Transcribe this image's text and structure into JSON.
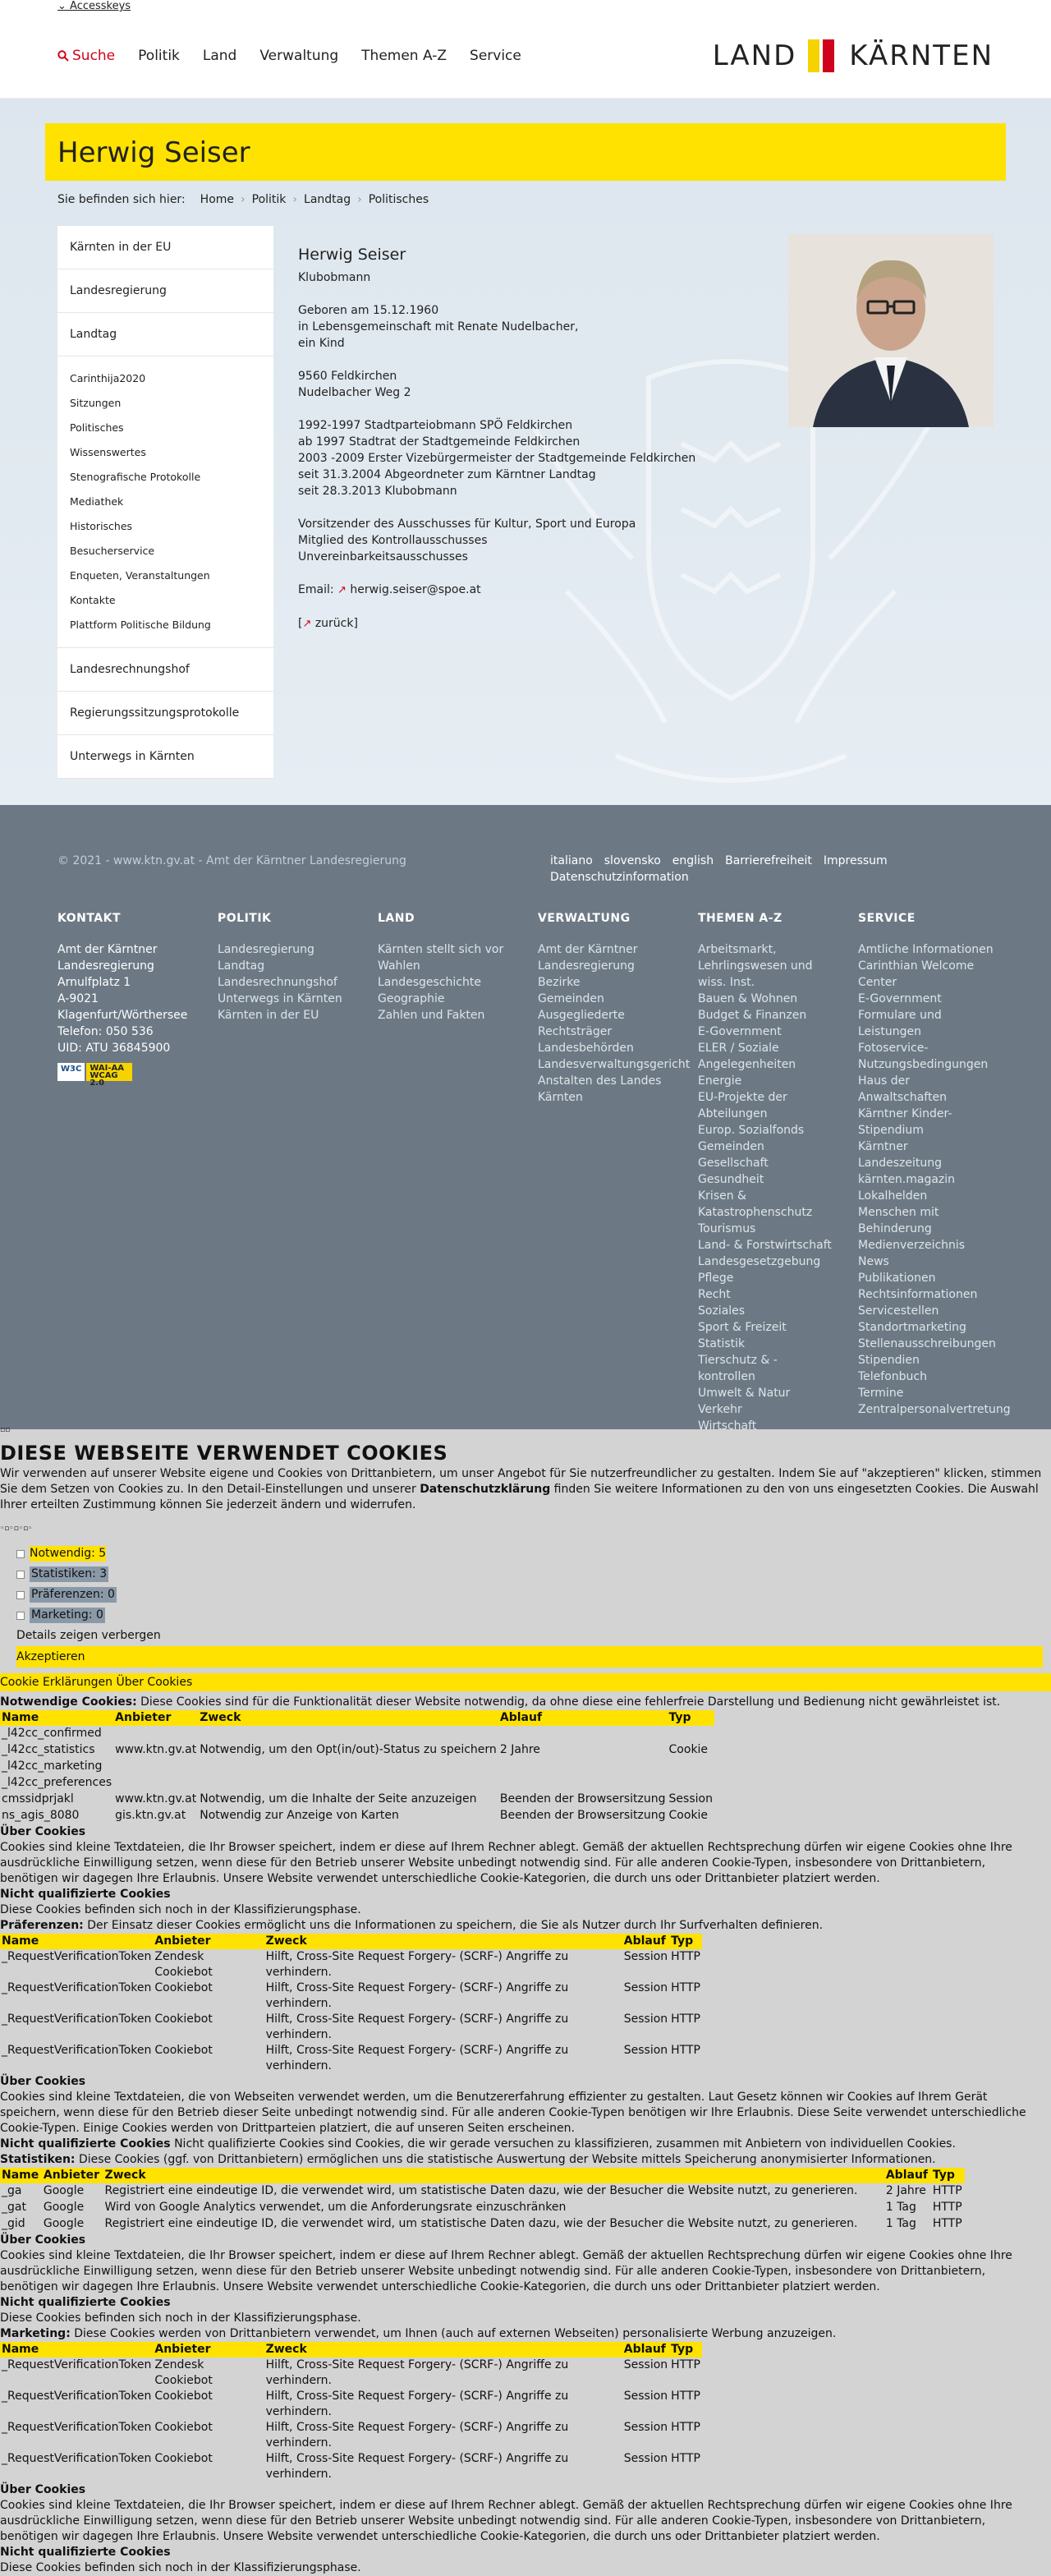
{
  "topbar": {
    "accesskeys": "Accesskeys"
  },
  "nav": {
    "search": "Suche",
    "items": [
      "Politik",
      "Land",
      "Verwaltung",
      "Themen A-Z",
      "Service"
    ]
  },
  "logo": {
    "left": "LAND",
    "right": "KÄRNTEN"
  },
  "page": {
    "title": "Herwig Seiser"
  },
  "breadcrumb": {
    "label": "Sie befinden sich hier:",
    "items": [
      "Home",
      "Politik",
      "Landtag",
      "Politisches"
    ]
  },
  "sidebar": {
    "top": [
      "Kärnten in der EU",
      "Landesregierung",
      "Landtag"
    ],
    "sub": [
      "Carinthija2020",
      "Sitzungen",
      "Politisches",
      "Wissenswertes",
      "Stenografische Protokolle",
      "Mediathek",
      "Historisches",
      "Besucherservice",
      "Enqueten, Veranstaltungen",
      "Kontakte",
      "Plattform Politische Bildung"
    ],
    "bottom": [
      "Landesrechnungshof",
      "Regierungssitzungsprotokolle",
      "Unterwegs in Kärnten"
    ]
  },
  "content": {
    "name": "Herwig Seiser",
    "role": "Klubobmann",
    "p1": [
      "Geboren am 15.12.1960",
      "in Lebensgemeinschaft mit Renate Nudelbacher,",
      "ein Kind"
    ],
    "p2": [
      "9560 Feldkirchen",
      "Nudelbacher Weg 2"
    ],
    "p3": [
      "1992-1997 Stadtparteiobmann SPÖ Feldkirchen",
      "ab 1997 Stadtrat der Stadtgemeinde Feldkirchen",
      "2003 -2009 Erster Vizebürgermeister der Stadtgemeinde Feldkirchen",
      "seit 31.3.2004 Abgeordneter zum Kärntner Landtag",
      "seit 28.3.2013 Klubobmann"
    ],
    "p4": [
      "Vorsitzender des Ausschusses für Kultur, Sport und Europa",
      "Mitglied des Kontrollausschusses",
      "Unvereinbarkeitsausschusses"
    ],
    "email_label": "Email:",
    "email": "herwig.seiser@spoe.at",
    "back": "zurück"
  },
  "footer": {
    "copyright": "© 2021 - www.ktn.gv.at - Amt der Kärntner Landesregierung",
    "links": [
      "italiano",
      "slovensko",
      "english",
      "Barrierefreiheit",
      "Impressum",
      "Datenschutzinformation"
    ],
    "kontakt": {
      "title": "KONTAKT",
      "lines": [
        "Amt der Kärntner",
        "Landesregierung",
        "Arnulfplatz 1",
        "A-9021",
        "Klagenfurt/Wörthersee",
        "Telefon: 050 536",
        "UID: ATU 36845900"
      ],
      "wai_left": "W3C",
      "wai_right": "WAI-AA WCAG 2.0"
    },
    "politik": {
      "title": "POLITIK",
      "items": [
        "Landesregierung",
        "Landtag",
        "Landesrechnungshof",
        "Unterwegs in Kärnten",
        "Kärnten in der EU"
      ]
    },
    "land": {
      "title": "LAND",
      "items": [
        "Kärnten stellt sich vor",
        "Wahlen",
        "Landesgeschichte",
        "Geographie",
        "Zahlen und Fakten"
      ]
    },
    "verwaltung": {
      "title": "VERWALTUNG",
      "items": [
        "Amt der Kärntner",
        "Landesregierung",
        "Bezirke",
        "Gemeinden",
        "Ausgegliederte",
        "Rechtsträger",
        "Landesbehörden",
        "Landesverwaltungsgericht",
        "Anstalten des Landes",
        "Kärnten"
      ]
    },
    "themen": {
      "title": "THEMEN A-Z",
      "items": [
        "Arbeitsmarkt,",
        "Lehrlingswesen und",
        "wiss. Inst.",
        "Bauen & Wohnen",
        "Budget & Finanzen",
        "E-Government",
        "ELER / Soziale",
        "Angelegenheiten",
        "Energie",
        "EU-Projekte der",
        "Abteilungen",
        "Europ. Sozialfonds",
        "Gemeinden",
        "Gesellschaft",
        "Gesundheit",
        "Krisen &",
        "Katastrophenschutz",
        "Tourismus",
        "Land- & Forstwirtschaft",
        "Landesgesetzgebung",
        "Pflege",
        "Recht",
        "Soziales",
        "Sport & Freizeit",
        "Statistik",
        "Tierschutz & -",
        "kontrollen",
        "Umwelt & Natur",
        "Verkehr",
        "Wirtschaft"
      ]
    },
    "service": {
      "title": "SERVICE",
      "items": [
        "Amtliche Informationen",
        "Carinthian Welcome",
        "Center",
        "E-Government",
        "Formulare und",
        "Leistungen",
        "Fotoservice-",
        "Nutzungsbedingungen",
        "Haus der",
        "Anwaltschaften",
        "Kärntner Kinder-",
        "Stipendium",
        "Kärntner",
        "Landeszeitung",
        "kärnten.magazin",
        "Lokalhelden",
        "Menschen mit",
        "Behinderung",
        "Medienverzeichnis",
        "News",
        "Publikationen",
        "Rechtsinformationen",
        "Servicestellen",
        "Standortmarketing",
        "Stellenausschreibungen",
        "Stipendien",
        "Telefonbuch",
        "Termine",
        "Zentralpersonalvertretung"
      ]
    }
  },
  "cookie": {
    "heading": "DIESE WEBSEITE VERWENDET COOKIES",
    "intro_a": "Wir verwenden auf unserer Website eigene und Cookies von Drittanbietern, um unser Angebot für Sie nutzerfreundlicher zu gestalten. Indem Sie auf \"akzeptieren\" klicken, stimmen Sie dem Setzen von Cookies zu. In den Detail-Einstellungen und unserer ",
    "intro_link": "Datenschutzklärung",
    "intro_b": " finden Sie weitere Informationen zu den von uns eingesetzten Cookies. Die Auswahl Ihrer erteilten Zustimmung können Sie jederzeit ändern und widerrufen.",
    "categories": [
      "Notwendig: 5",
      "Statistiken: 3",
      "Präferenzen: 0",
      "Marketing: 0"
    ],
    "details": "Details zeigen verbergen",
    "accept": "Akzeptieren",
    "tabs": "Cookie Erklärungen Über Cookies",
    "nec_label": "Notwendige Cookies:",
    "nec_text": " Diese Cookies sind für die Funktionalität dieser Website notwendig, da ohne diese eine fehlerfreie Darstellung und Bedienung nicht gewährleistet ist.",
    "nec_headers": [
      "Name",
      "Anbieter",
      "Zweck",
      "Ablauf",
      "Typ"
    ],
    "nec_rows": [
      [
        "_l42cc_confirmed",
        "",
        "",
        "",
        ""
      ],
      [
        "_l42cc_statistics",
        "www.ktn.gv.at",
        "Notwendig, um den Opt(in/out)-Status zu speichern",
        "2 Jahre",
        "Cookie"
      ],
      [
        "_l42cc_marketing",
        "",
        "",
        "",
        ""
      ],
      [
        "_l42cc_preferences",
        "",
        "",
        "",
        ""
      ],
      [
        "cmssidprjakl",
        "www.ktn.gv.at",
        "Notwendig, um die Inhalte der Seite anzuzeigen",
        "Beenden der Browsersitzung",
        "Session"
      ],
      [
        "ns_agis_8080",
        "gis.ktn.gv.at",
        "Notwendig zur Anzeige von Karten",
        "Beenden der Browsersitzung",
        "Cookie"
      ]
    ],
    "about_title": "Über Cookies",
    "about_text": "Cookies sind kleine Textdateien, die Ihr Browser speichert, indem er diese auf Ihrem Rechner ablegt. Gemäß der aktuellen Rechtsprechung dürfen wir eigene Cookies ohne Ihre ausdrückliche Einwilligung setzen, wenn diese für den Betrieb unserer Website unbedingt notwendig sind. Für alle anderen Cookie-Typen, insbesondere von Drittanbietern, benötigen wir dagegen Ihre Erlaubnis. Unsere Website verwendet unterschiedliche Cookie-Kategorien, die durch uns oder Drittanbieter platziert werden.",
    "nq_title": "Nicht qualifizierte Cookies",
    "nq_text": "Diese Cookies befinden sich noch in der Klassifizierungsphase.",
    "pref_label": "Präferenzen:",
    "pref_text": " Der Einsatz dieser Cookies ermöglicht uns die Informationen zu speichern, die Sie als Nutzer durch Ihr Surfverhalten definieren.",
    "pref_headers": [
      "Name",
      "Anbieter",
      "Zweck",
      "Ablauf",
      "Typ"
    ],
    "csrf_rows": [
      [
        "_RequestVerificationToken",
        "Zendesk Cookiebot",
        "Hilft, Cross-Site Request Forgery- (SCRF-) Angriffe zu verhindern.",
        "Session",
        "HTTP"
      ],
      [
        "_RequestVerificationToken",
        "Cookiebot",
        "Hilft, Cross-Site Request Forgery- (SCRF-) Angriffe zu verhindern.",
        "Session",
        "HTTP"
      ],
      [
        "_RequestVerificationToken",
        "Cookiebot",
        "Hilft, Cross-Site Request Forgery- (SCRF-) Angriffe zu verhindern.",
        "Session",
        "HTTP"
      ],
      [
        "_RequestVerificationToken",
        "Cookiebot",
        "Hilft, Cross-Site Request Forgery- (SCRF-) Angriffe zu verhindern.",
        "Session",
        "HTTP"
      ]
    ],
    "about2_text": "Cookies sind kleine Textdateien, die von Webseiten verwendet werden, um die Benutzererfahrung effizienter zu gestalten. Laut Gesetz können wir Cookies auf Ihrem Gerät speichern, wenn diese für den Betrieb dieser Seite unbedingt notwendig sind. Für alle anderen Cookie-Typen benötigen wir Ihre Erlaubnis. Diese Seite verwendet unterschiedliche Cookie-Typen. Einige Cookies werden von Drittparteien platziert, die auf unseren Seiten erscheinen.",
    "nq2_line": "Nicht qualifizierte Cookies sind Cookies, die wir gerade versuchen zu klassifizieren, zusammen mit Anbietern von individuellen Cookies.",
    "stat_label": "Statistiken:",
    "stat_text": " Diese Cookies (ggf. von Drittanbietern) ermöglichen uns die statistische Auswertung der Website mittels Speicherung anonymisierter Informationen.",
    "stat_headers": [
      "Name",
      "Anbieter",
      "Zweck",
      "Ablauf",
      "Typ"
    ],
    "stat_rows": [
      [
        "_ga",
        "Google",
        "Registriert eine eindeutige ID, die verwendet wird, um statistische Daten dazu, wie der Besucher die Website nutzt, zu generieren.",
        "2 Jahre",
        "HTTP"
      ],
      [
        "_gat",
        "Google",
        "Wird von Google Analytics verwendet, um die Anforderungsrate einzuschränken",
        "1 Tag",
        "HTTP"
      ],
      [
        "_gid",
        "Google",
        "Registriert eine eindeutige ID, die verwendet wird, um statistische Daten dazu, wie der Besucher die Website nutzt, zu generieren.",
        "1 Tag",
        "HTTP"
      ]
    ],
    "mkt_label": "Marketing:",
    "mkt_text": " Diese Cookies werden von Drittanbietern verwendet, um Ihnen (auch auf externen Webseiten) personalisierte Werbung anzuzeigen."
  }
}
